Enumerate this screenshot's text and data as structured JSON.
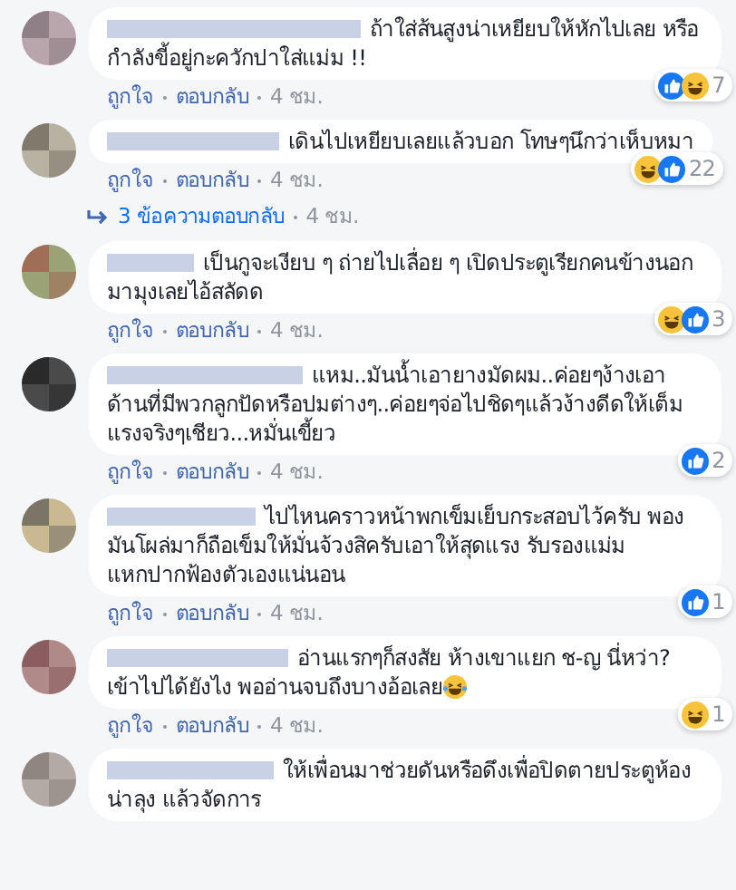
{
  "comments": [
    {
      "text": "ถ้าใส่ส้นสูงน่าเหยียบให้หักไปเลย หรือกำลังขี้อยู่กะควักปาใส่แม่ม !!",
      "reactions": [
        {
          "kind": "like"
        },
        {
          "kind": "haha"
        }
      ],
      "reaction_count": "7",
      "actions": [
        {
          "label": "ถูกใจ"
        },
        {
          "label": "ตอบกลับ"
        }
      ],
      "time": "4 ชม."
    },
    {
      "text": "เดินไปเหยียบเลยแล้วบอก โทษๆนึกว่าเห็บหมา",
      "reactions": [
        {
          "kind": "haha"
        },
        {
          "kind": "like"
        }
      ],
      "reaction_count": "22",
      "actions": [
        {
          "label": "ถูกใจ"
        },
        {
          "label": "ตอบกลับ"
        }
      ],
      "time": "4 ชม.",
      "replies": {
        "label": "3 ข้อความตอบกลับ",
        "time": "4 ชม."
      }
    },
    {
      "text": "เป็นกูจะเงียบ ๆ ถ่ายไปเลื่อย ๆ เปิดประตูเรียกคนข้างนอกมามุงเลยไอ้สลัดด",
      "reactions": [
        {
          "kind": "haha"
        },
        {
          "kind": "like"
        }
      ],
      "reaction_count": "3",
      "actions": [
        {
          "label": "ถูกใจ"
        },
        {
          "label": "ตอบกลับ"
        }
      ],
      "time": "4 ชม."
    },
    {
      "text": "แหม..มันน้ำเอายางมัดผม..ค่อยๆง้างเอาด้านที่มีพวกลูกปัดหรือปมต่างๆ..ค่อยๆจ่อไปชิดๆแล้วง้างดีดให้เต็มแรงจริงๆเชียว...หมั่นเขี้ยว",
      "reactions": [
        {
          "kind": "like"
        }
      ],
      "reaction_count": "2",
      "actions": [
        {
          "label": "ถูกใจ"
        },
        {
          "label": "ตอบกลับ"
        }
      ],
      "time": "4 ชม."
    },
    {
      "text": "ไปไหนคราวหน้าพกเข็มเย็บกระสอบไว้ครับ พองมันโผล่มาก็ถือเข็มให้มั่นจ้วงสิครับเอาให้สุดแรง รับรองแม่มแหกปากฟ้องตัวเองแน่นอน",
      "reactions": [
        {
          "kind": "like"
        }
      ],
      "reaction_count": "1",
      "actions": [
        {
          "label": "ถูกใจ"
        },
        {
          "label": "ตอบกลับ"
        }
      ],
      "time": "4 ชม."
    },
    {
      "text": "อ่านแรกๆก็สงสัย ห้างเขาแยก ช-ญ นี่หว่า? เข้าไปได้ยังไง พออ่านจบถึงบางอ้อเลย",
      "trailing_emoji": {
        "kind": "laugh"
      },
      "reactions": [
        {
          "kind": "haha"
        }
      ],
      "reaction_count": "1",
      "actions": [
        {
          "label": "ถูกใจ"
        },
        {
          "label": "ตอบกลับ"
        }
      ],
      "time": "4 ชม."
    },
    {
      "text": "ให้เพื่อนมาช่วยดันหรือดึงเพื่อปิดตายประตูห้องน่าลุง แล้วจัดการ"
    }
  ]
}
